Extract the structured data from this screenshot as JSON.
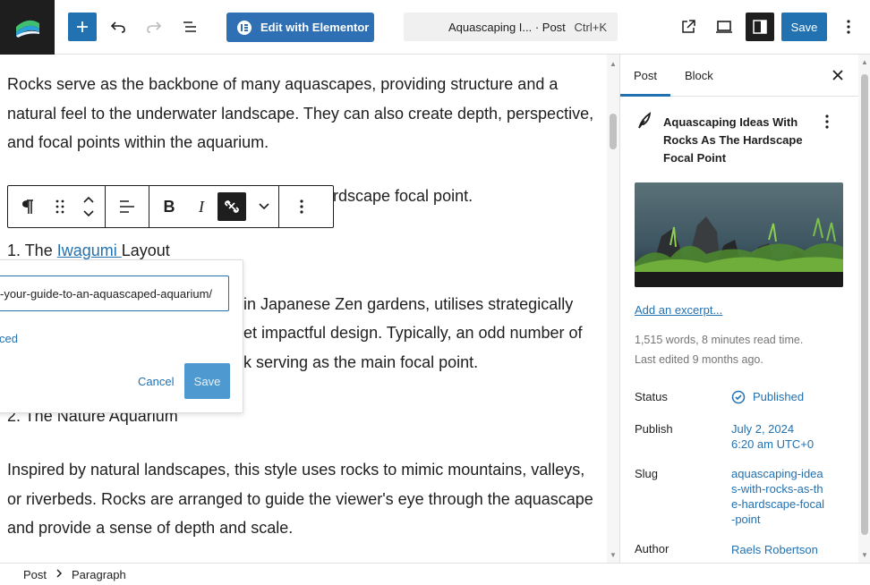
{
  "topbar": {
    "edit_elementor": "Edit with Elementor",
    "command_title": "Aquascaping I... · Post",
    "command_shortcut": "Ctrl+K",
    "save": "Save"
  },
  "content": {
    "p1": "Rocks serve as the backbone of many aquascapes, providing structure and a natural feel to the underwater landscape. They can also create depth, perspective, and focal points within the aquarium.",
    "p2_visible": "rdscape focal point.",
    "item1_prefix": "1. The ",
    "item1_link": "Iwagumi ",
    "item1_suffix": "Layout",
    "p3_line1": "in Japanese Zen gardens, utilises strategically",
    "p3_line2": "et impactful design. Typically, an odd number of",
    "p3_line3": "k serving as the main focal point.",
    "item2": "2. The Nature Aquarium",
    "p4": "Inspired by natural landscapes, this style uses rocks to mimic mountains, valleys, or riverbeds. Rocks are arranged to guide the viewer's eye through the aquascape and provide a sense of depth and scale."
  },
  "link_popover": {
    "url_value": "-your-guide-to-an-aquascaped-aquarium/",
    "advanced": "ced",
    "cancel": "Cancel",
    "save": "Save"
  },
  "sidebar": {
    "tab_post": "Post",
    "tab_block": "Block",
    "post_title": "Aquascaping Ideas With Rocks As The Hardscape Focal Point",
    "add_excerpt": "Add an excerpt...",
    "read_time": "1,515 words, 8 minutes read time.",
    "last_edited": "Last edited 9 months ago.",
    "status_label": "Status",
    "status_value": "Published",
    "publish_label": "Publish",
    "publish_date": "July 2, 2024",
    "publish_time": "6:20 am UTC+0",
    "slug_label": "Slug",
    "slug_value": "aquascaping-ideas-with-rocks-as-the-hardscape-focal-point",
    "author_label": "Author",
    "author_value": "Raels Robertson"
  },
  "footer": {
    "crumb1": "Post",
    "crumb2": "Paragraph"
  },
  "colors": {
    "accent": "#2271b1",
    "dark": "#1e1e1e"
  }
}
